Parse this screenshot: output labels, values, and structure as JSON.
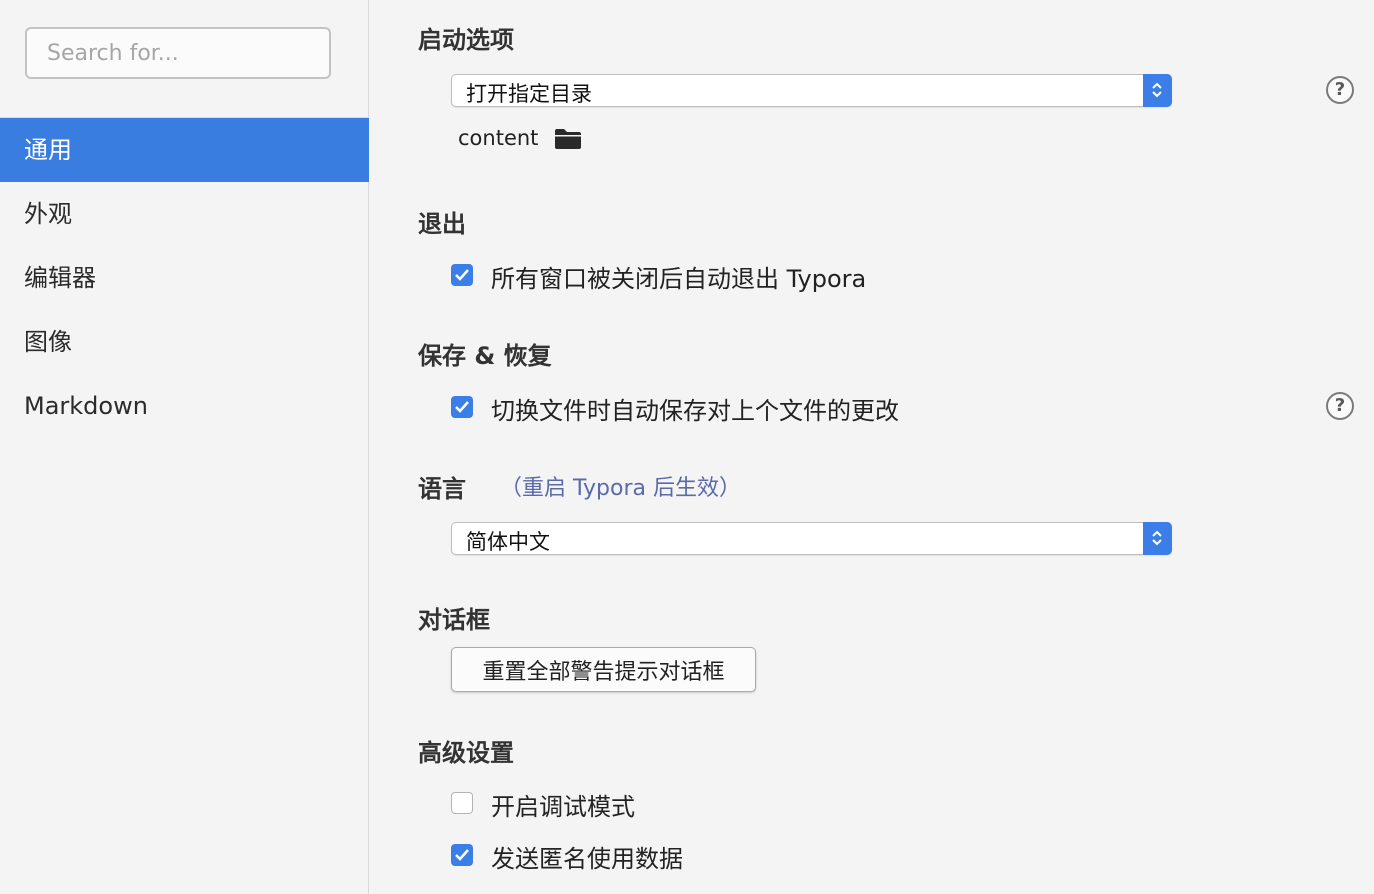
{
  "search": {
    "placeholder": "Search for..."
  },
  "sidebar": {
    "items": [
      {
        "label": "通用",
        "active": true
      },
      {
        "label": "外观"
      },
      {
        "label": "编辑器"
      },
      {
        "label": "图像"
      },
      {
        "label": "Markdown"
      }
    ]
  },
  "startup": {
    "title": "启动选项",
    "select_value": "打开指定目录",
    "folder_path": "content"
  },
  "quit": {
    "title": "退出",
    "checkbox_label": "所有窗口被关闭后自动退出 Typora",
    "checked": true
  },
  "save": {
    "title": "保存 & 恢复",
    "checkbox_label": "切换文件时自动保存对上个文件的更改",
    "checked": true
  },
  "language": {
    "title": "语言",
    "hint": "（重启 Typora 后生效）",
    "select_value": "简体中文"
  },
  "dialog": {
    "title": "对话框",
    "button_label": "重置全部警告提示对话框"
  },
  "advanced": {
    "title": "高级设置",
    "debug_label": "开启调试模式",
    "debug_checked": false,
    "analytics_label": "发送匿名使用数据",
    "analytics_checked": true
  },
  "help_glyph": "?",
  "colors": {
    "accent": "#3b7ee8",
    "sidebar_active": "#3a7de0",
    "hint": "#5b6aa8"
  },
  "icons": [
    "search-input",
    "folder-icon",
    "help-icon",
    "stepper-icon",
    "checkmark-icon"
  ]
}
